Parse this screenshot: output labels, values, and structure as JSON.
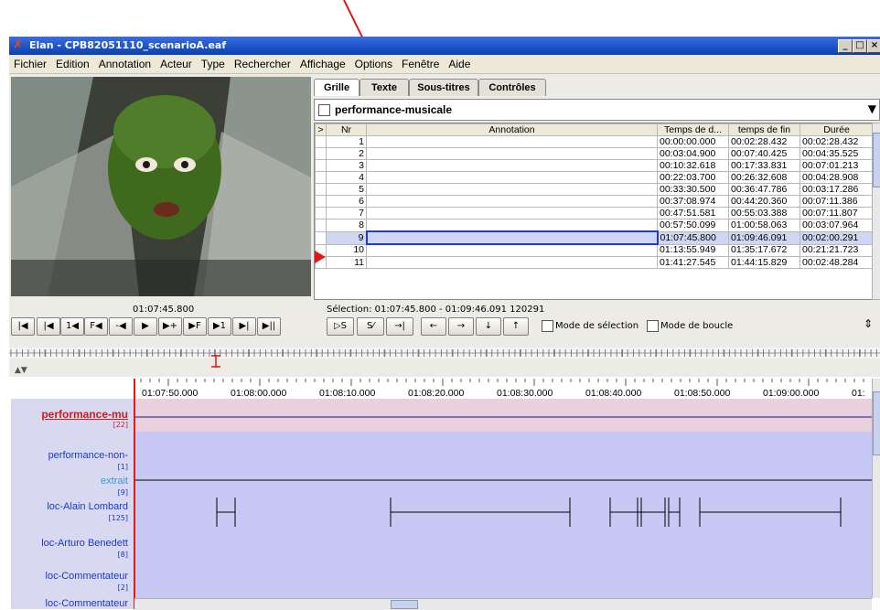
{
  "window": {
    "title": "Elan - CPB82051110_scenarioA.eaf"
  },
  "menu": [
    "Fichier",
    "Edition",
    "Annotation",
    "Acteur",
    "Type",
    "Rechercher",
    "Affichage",
    "Options",
    "Fenêtre",
    "Aide"
  ],
  "tabs": [
    "Grille",
    "Texte",
    "Sous-titres",
    "Contrôles"
  ],
  "tier_select": "performance-musicale",
  "grid": {
    "headers": [
      ">",
      "Nr",
      "Annotation",
      "Temps de d...",
      "temps de fin",
      "Durée"
    ],
    "rows": [
      {
        "nr": "1",
        "start": "00:00:00.000",
        "end": "00:02:28.432",
        "dur": "00:02:28.432"
      },
      {
        "nr": "2",
        "start": "00:03:04.900",
        "end": "00:07:40.425",
        "dur": "00:04:35.525"
      },
      {
        "nr": "3",
        "start": "00:10:32.618",
        "end": "00:17:33.831",
        "dur": "00:07:01.213"
      },
      {
        "nr": "4",
        "start": "00:22:03.700",
        "end": "00:26:32.608",
        "dur": "00:04:28.908"
      },
      {
        "nr": "5",
        "start": "00:33:30.500",
        "end": "00:36:47.786",
        "dur": "00:03:17.286"
      },
      {
        "nr": "6",
        "start": "00:37:08.974",
        "end": "00:44:20.360",
        "dur": "00:07:11.386"
      },
      {
        "nr": "7",
        "start": "00:47:51.581",
        "end": "00:55:03.388",
        "dur": "00:07:11.807"
      },
      {
        "nr": "8",
        "start": "00:57:50.099",
        "end": "01:00:58.063",
        "dur": "00:03:07.964"
      },
      {
        "nr": "9",
        "start": "01:07:45.800",
        "end": "01:09:46.091",
        "dur": "00:02:00.291"
      },
      {
        "nr": "10",
        "start": "01:13:55.949",
        "end": "01:35:17.672",
        "dur": "00:21:21.723"
      },
      {
        "nr": "11",
        "start": "01:41:27.545",
        "end": "01:44:15.829",
        "dur": "00:02:48.284"
      }
    ],
    "selected_nr": "9"
  },
  "player": {
    "current_time": "01:07:45.800",
    "selection": "Sélection: 01:07:45.800 - 01:09:46.091  120291",
    "buttons": [
      "|◀",
      "|◀",
      "1◀",
      "F◀",
      "-◀",
      "▶",
      "▶+",
      "▶F",
      "▶1",
      "▶|",
      "▶||"
    ],
    "sel_buttons": [
      "▷S",
      "S⁄",
      "→|"
    ],
    "nav_buttons": [
      "←",
      "→",
      "↓",
      "↑"
    ],
    "mode_selection": "Mode de sélection",
    "mode_boucle": "Mode de boucle"
  },
  "ruler_ticks": [
    "01:07:50.000",
    "01:08:00.000",
    "01:08:10.000",
    "01:08:20.000",
    "01:08:30.000",
    "01:08:40.000",
    "01:08:50.000",
    "01:09:00.000",
    "01:"
  ],
  "tiers": [
    {
      "name": "performance-mu",
      "count": "[22]"
    },
    {
      "name": "performance-non-",
      "count": "[1]"
    },
    {
      "name": "extrait",
      "count": "[9]"
    },
    {
      "name": "loc-Alain Lombard",
      "count": "[125]"
    },
    {
      "name": "loc-Arturo Benedett",
      "count": "[8]"
    },
    {
      "name": "loc-Commentateur",
      "count": "[2]"
    },
    {
      "name": "loc-Commentateur",
      "count": ""
    }
  ],
  "colors": {
    "accent": "#0a3fb0",
    "selected_tier": "#c81e1e",
    "tier_label": "#1a3ac8",
    "lanes": "#c8c8f4"
  }
}
